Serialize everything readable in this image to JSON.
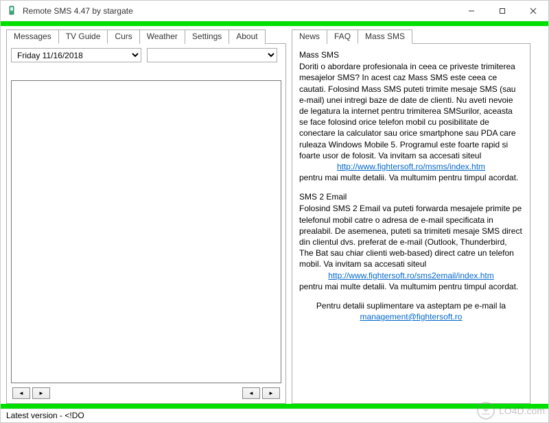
{
  "window": {
    "title": "Remote SMS 4.47 by stargate"
  },
  "leftTabs": [
    "Messages",
    "TV Guide",
    "Curs",
    "Weather",
    "Settings",
    "About"
  ],
  "leftActiveTab": 1,
  "dateDropdown": {
    "value": "Friday 11/16/2018"
  },
  "secondDropdown": {
    "value": ""
  },
  "navButtons": {
    "leftArrow": "◄",
    "rightArrow": "►"
  },
  "rightTabs": [
    "News",
    "FAQ",
    "Mass SMS"
  ],
  "rightActiveTab": 2,
  "massSms": {
    "section1": {
      "title": "Mass SMS",
      "body1": "Doriti o abordare profesionala in ceea ce priveste trimiterea mesajelor SMS? In acest caz Mass SMS este ceea ce cautati. Folosind Mass SMS puteti trimite mesaje SMS (sau e-mail) unei intregi baze de date de clienti. Nu aveti nevoie de legatura la internet pentru trimiterea SMSurilor, aceasta se face folosind orice telefon mobil cu posibilitate de conectare la calculator sau orice smartphone sau PDA care ruleaza Windows Mobile 5. Programul este foarte rapid si foarte usor de folosit. Va invitam sa accesati siteul",
      "link": "http://www.fightersoft.ro/msms/index.htm",
      "body2": "pentru mai multe detalii. Va multumim pentru timpul acordat."
    },
    "section2": {
      "title": "SMS 2 Email",
      "body1": "Folosind SMS 2 Email va puteti forwarda mesajele primite pe telefonul mobil catre o adresa de e-mail specificata in prealabil. De asemenea, puteti sa trimiteti mesaje SMS direct din clientul dvs. preferat de e-mail (Outlook, Thunderbird, The Bat sau chiar clienti web-based) direct catre un telefon mobil. Va invitam sa accesati siteul",
      "link": "http://www.fightersoft.ro/sms2email/index.htm",
      "body2": "pentru mai multe detalii. Va multumim pentru timpul acordat."
    },
    "footer": {
      "text": "Pentru detalii suplimentare va asteptam pe e-mail la",
      "email": "management@fightersoft.ro"
    }
  },
  "statusBar": "Latest version - <!DO",
  "watermark": "LO4D.com"
}
